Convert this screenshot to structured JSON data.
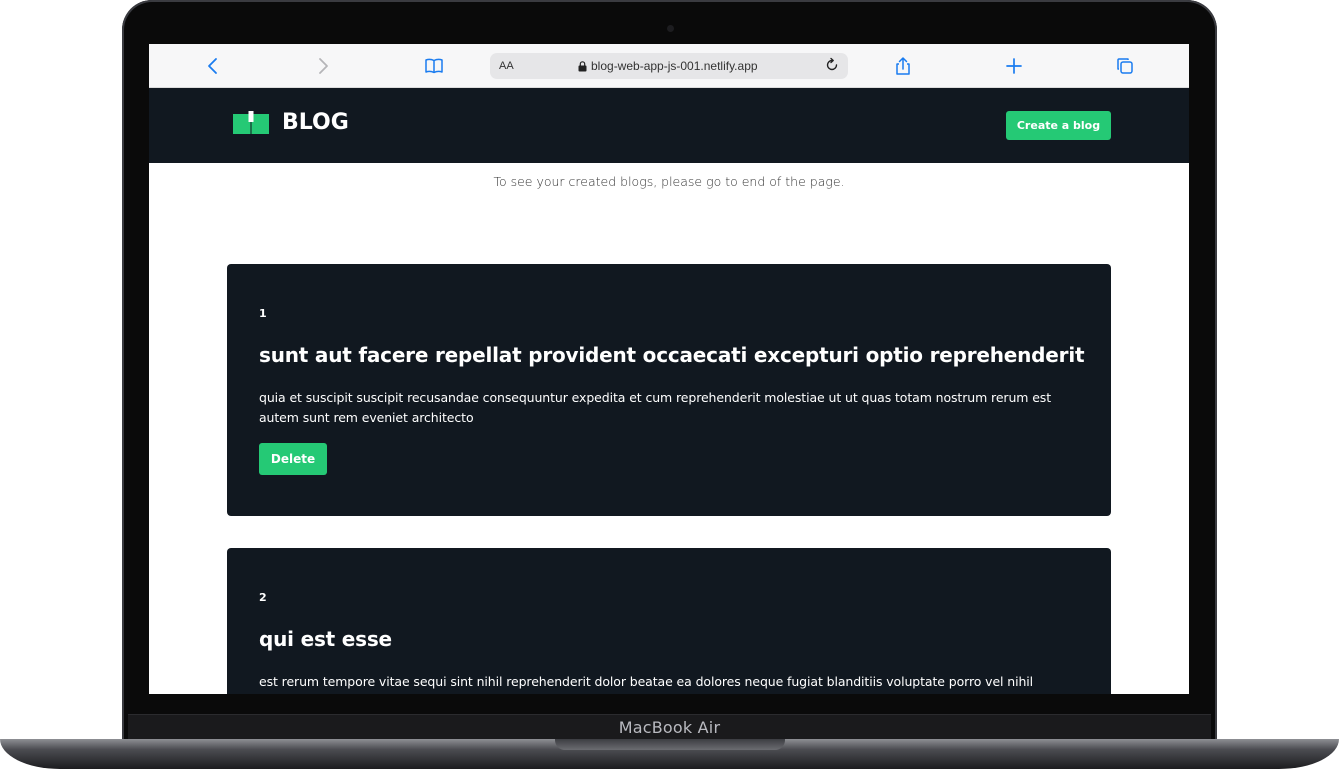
{
  "device": {
    "label": "MacBook Air"
  },
  "browser": {
    "text_size_label": "AA",
    "url": "blog-web-app-js-001.netlify.app"
  },
  "header": {
    "brand": "BLOG",
    "create_label": "Create a blog"
  },
  "notice": "To see your created blogs, please go to end of the page.",
  "posts": [
    {
      "id": "1",
      "title": "sunt aut facere repellat provident occaecati excepturi optio reprehenderit",
      "body": "quia et suscipit suscipit recusandae consequuntur expedita et cum reprehenderit molestiae ut ut quas totam nostrum rerum est autem sunt rem eveniet architecto",
      "delete_label": "Delete"
    },
    {
      "id": "2",
      "title": "qui est esse",
      "body": "est rerum tempore vitae sequi sint nihil reprehenderit dolor beatae ea dolores neque fugiat blanditiis voluptate porro vel nihil"
    }
  ],
  "colors": {
    "accent": "#25c975",
    "dark_bg": "#111820",
    "browser_blue": "#1a7cf0"
  },
  "icons": {
    "back": "chevron-left-icon",
    "forward": "chevron-right-icon",
    "bookmarks": "book-icon",
    "lock": "lock-icon",
    "reload": "reload-icon",
    "share": "share-icon",
    "new_tab": "plus-icon",
    "tabs": "tabs-icon",
    "logo": "open-book-icon"
  }
}
